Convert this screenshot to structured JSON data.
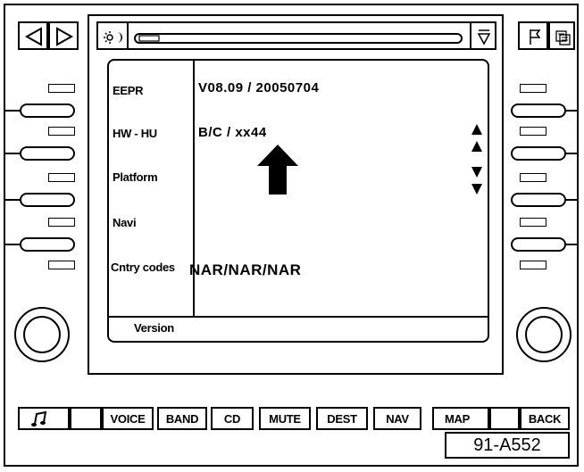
{
  "screen": {
    "rows": [
      {
        "label": "EEPR",
        "value": "V08.09 / 20050704"
      },
      {
        "label": "HW - HU",
        "value": "B/C / xx44"
      },
      {
        "label": "Platform",
        "value": ""
      },
      {
        "label": "Navi",
        "value": ""
      },
      {
        "label": "Cntry codes",
        "value": "NAR/NAR/NAR"
      }
    ],
    "footer_label": "Version"
  },
  "bottom_buttons": [
    {
      "label": "",
      "icon": "music-note-icon"
    },
    {
      "label": ""
    },
    {
      "label": "VOICE"
    },
    {
      "label": "BAND"
    },
    {
      "label": "CD"
    },
    {
      "label": "MUTE"
    },
    {
      "label": "DEST"
    },
    {
      "label": "NAV"
    },
    {
      "label": "MAP"
    },
    {
      "label": ""
    },
    {
      "label": "BACK"
    }
  ],
  "figure_id": "91-A552",
  "icons": {
    "top_left": [
      "triangle-left-icon",
      "triangle-right-icon"
    ],
    "top_center": [
      "sun-moon-icon",
      "cd-slot-icon",
      "eject-icon"
    ],
    "top_right": [
      "flag-icon",
      "screen-copy-icon"
    ],
    "screen_indicator": "arrow-up-icon",
    "scroll": [
      "scroll-up-icon",
      "scroll-down-icon"
    ]
  }
}
